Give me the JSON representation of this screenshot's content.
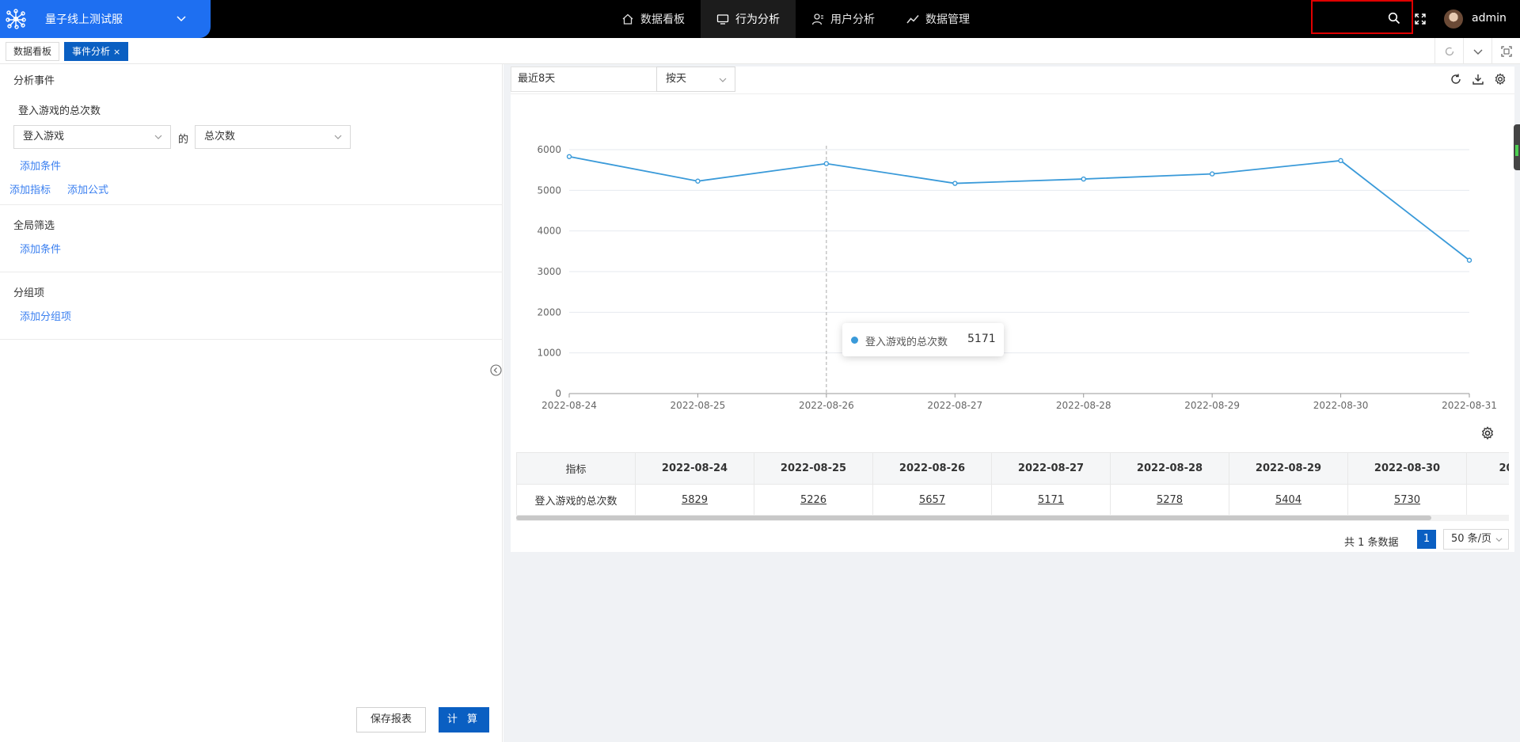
{
  "app": {
    "project_name": "量子线上测试服",
    "user_name": "admin"
  },
  "nav": {
    "items": [
      {
        "label": "数据看板",
        "icon": "home-icon"
      },
      {
        "label": "行为分析",
        "icon": "monitor-icon",
        "active": true
      },
      {
        "label": "用户分析",
        "icon": "user-icon"
      },
      {
        "label": "数据管理",
        "icon": "trend-icon"
      }
    ]
  },
  "tabs": [
    {
      "label": "数据看板",
      "active": false
    },
    {
      "label": "事件分析",
      "active": true,
      "close": "×"
    }
  ],
  "left": {
    "analysis_title": "分析事件",
    "metric_name": "登入游戏的总次数",
    "event_select": "登入游戏",
    "of_label": "的",
    "measure_select": "总次数",
    "add_condition": "添加条件",
    "add_metric": "添加指标",
    "add_formula": "添加公式",
    "global_filter_title": "全局筛选",
    "global_add_condition": "添加条件",
    "group_title": "分组项",
    "add_group": "添加分组项",
    "save_button": "保存报表",
    "calc_button": "计 算"
  },
  "right": {
    "date_range": "最近8天",
    "granularity": "按天",
    "tooltip": {
      "label": "登入游戏的总次数",
      "value": "5171"
    }
  },
  "chart_data": {
    "type": "line",
    "categories": [
      "2022-08-24",
      "2022-08-25",
      "2022-08-26",
      "2022-08-27",
      "2022-08-28",
      "2022-08-29",
      "2022-08-30",
      "2022-08-31"
    ],
    "series": [
      {
        "name": "登入游戏的总次数",
        "values": [
          5829,
          5226,
          5657,
          5171,
          5278,
          5404,
          5730,
          3280
        ],
        "color": "#3a9ad9"
      }
    ],
    "ylim": [
      0,
      6000
    ],
    "yticks": [
      0,
      1000,
      2000,
      3000,
      4000,
      5000,
      6000
    ],
    "grid": true,
    "hover_index": 2
  },
  "table": {
    "header_metric": "指标",
    "columns": [
      "2022-08-24",
      "2022-08-25",
      "2022-08-26",
      "2022-08-27",
      "2022-08-28",
      "2022-08-29",
      "2022-08-30",
      "20"
    ],
    "rows": [
      {
        "metric": "登入游戏的总次数",
        "values": [
          "5829",
          "5226",
          "5657",
          "5171",
          "5278",
          "5404",
          "5730",
          ""
        ]
      }
    ]
  },
  "pager": {
    "total_text": "共 1 条数据",
    "current_page": "1",
    "page_size": "50 条/页"
  }
}
